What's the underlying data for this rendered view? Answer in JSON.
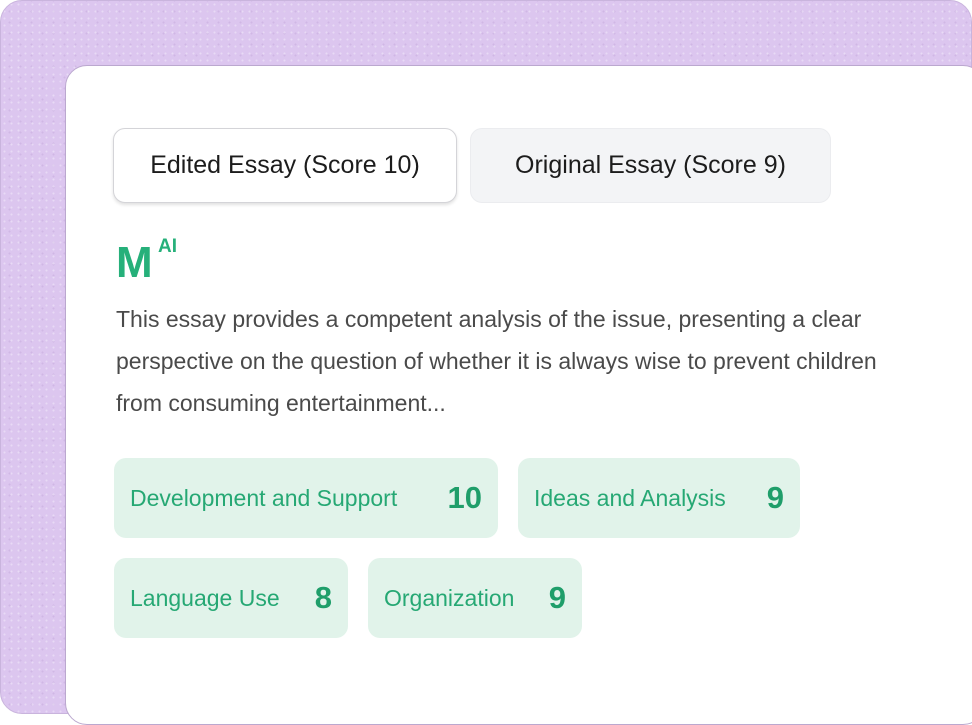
{
  "tabs": [
    {
      "label": "Edited Essay (Score 10)",
      "active": true
    },
    {
      "label": "Original Essay (Score 9)",
      "active": false
    }
  ],
  "logo": {
    "letter": "M",
    "superscript": "AI",
    "color": "#26b07a"
  },
  "summary": "This essay provides a competent analysis of the issue, presenting a clear perspective on the question of whether it is always wise to prevent children from consuming entertainment...",
  "criteria": [
    {
      "label": "Development and Support",
      "score": "10"
    },
    {
      "label": "Ideas and Analysis",
      "score": "9"
    },
    {
      "label": "Language Use",
      "score": "8"
    },
    {
      "label": "Organization",
      "score": "9"
    }
  ],
  "colors": {
    "frame_background": "#dcc6ef",
    "chip_background": "#e1f3ea",
    "chip_text": "#26a874"
  }
}
